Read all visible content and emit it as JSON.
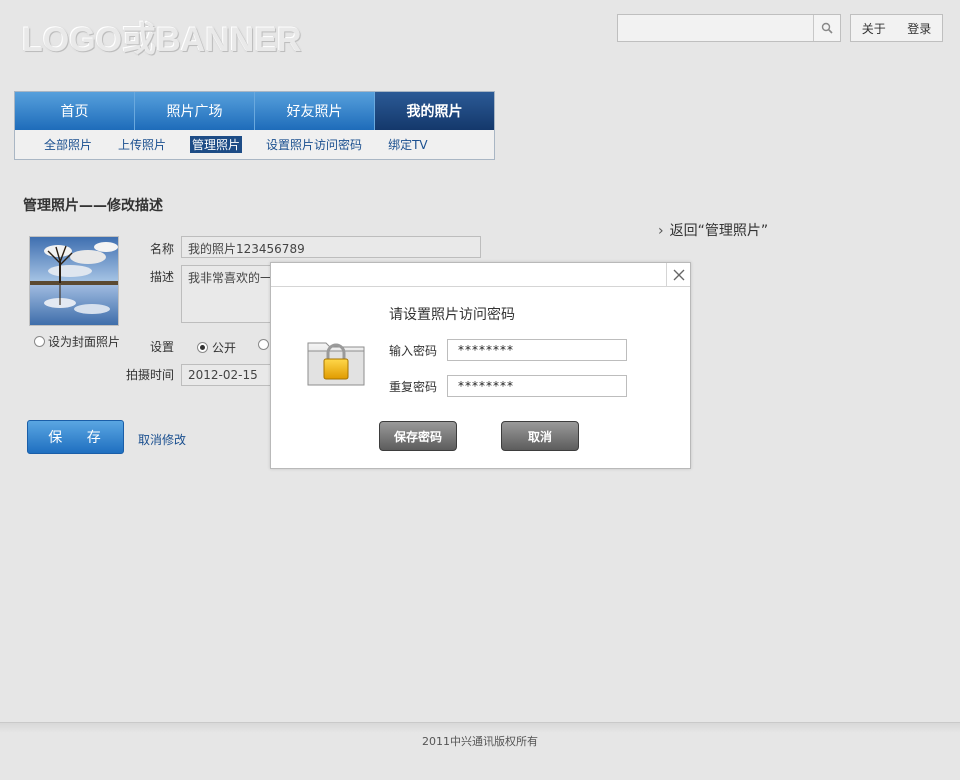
{
  "header": {
    "logo_text": "LOGO或BANNER",
    "search_placeholder": "",
    "links": [
      "关于",
      "登录"
    ]
  },
  "nav": {
    "tabs": [
      {
        "label": "首页",
        "active": false
      },
      {
        "label": "照片广场",
        "active": false
      },
      {
        "label": "好友照片",
        "active": false
      },
      {
        "label": "我的照片",
        "active": true
      }
    ],
    "sub_items": [
      {
        "label": "全部照片",
        "active": false
      },
      {
        "label": "上传照片",
        "active": false
      },
      {
        "label": "管理照片",
        "active": true
      },
      {
        "label": "设置照片访问密码",
        "active": false
      },
      {
        "label": "绑定TV",
        "active": false
      }
    ]
  },
  "main": {
    "page_title": "管理照片——修改描述",
    "back_link": "返回“管理照片”",
    "cover_option": "设为封面照片",
    "name_label": "名称",
    "name_value": "我的照片123456789",
    "desc_label": "描述",
    "desc_value": "我非常喜欢的一",
    "setting_label": "设置",
    "setting_public": "公开",
    "date_label": "拍摄时间",
    "date_value": "2012-02-15",
    "save_button": "保 存",
    "cancel_link": "取消修改"
  },
  "modal": {
    "title": "请设置照片访问密码",
    "password_label": "输入密码",
    "password_value": "********",
    "repeat_label": "重复密码",
    "repeat_value": "********",
    "save_button": "保存密码",
    "cancel_button": "取消"
  },
  "footer": {
    "copyright": "2011中兴通讯版权所有"
  },
  "colors": {
    "nav_blue": "#2f7fcb",
    "nav_active": "#1d4c86",
    "link_blue": "#1a4f8f",
    "background": "#e6e6e6"
  }
}
